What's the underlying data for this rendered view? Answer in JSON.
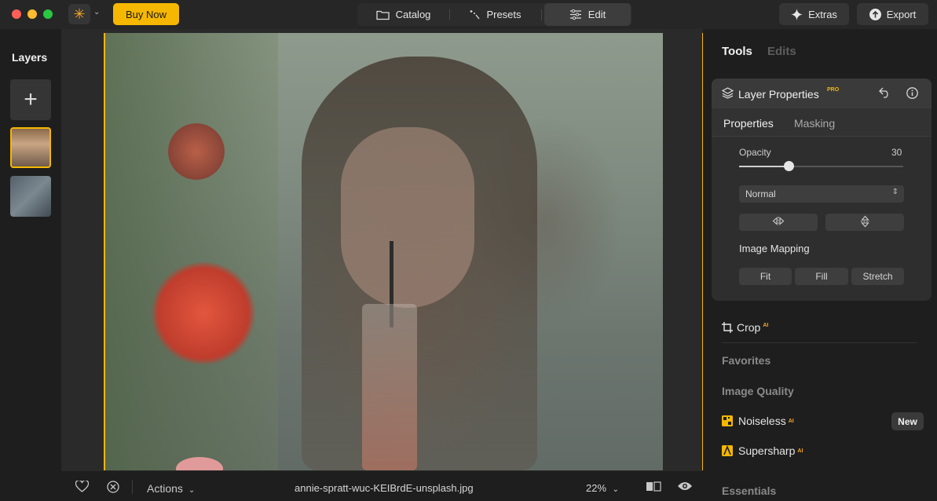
{
  "topbar": {
    "buy_now": "Buy Now",
    "nav": {
      "catalog": "Catalog",
      "presets": "Presets",
      "edit": "Edit"
    },
    "extras": "Extras",
    "export": "Export"
  },
  "layers": {
    "title": "Layers"
  },
  "bottombar": {
    "actions": "Actions",
    "filename": "annie-spratt-wuc-KEIBrdE-unsplash.jpg",
    "zoom": "22%"
  },
  "right": {
    "tabs": {
      "tools": "Tools",
      "edits": "Edits"
    },
    "layer_properties": {
      "title": "Layer Properties",
      "pro_badge": "PRO",
      "subtabs": {
        "properties": "Properties",
        "masking": "Masking"
      },
      "opacity_label": "Opacity",
      "opacity_value": "30",
      "opacity_fraction": 0.3,
      "blend_mode": "Normal",
      "image_mapping_label": "Image Mapping",
      "mapping": {
        "fit": "Fit",
        "fill": "Fill",
        "stretch": "Stretch"
      }
    },
    "crop": "Crop",
    "ai_badge": "AI",
    "sections": {
      "favorites": "Favorites",
      "image_quality": "Image Quality",
      "essentials": "Essentials"
    },
    "tools": {
      "noiseless": "Noiseless",
      "supersharp": "Supersharp"
    },
    "new_badge": "New"
  },
  "colors": {
    "accent": "#f5b700",
    "panel_bg": "#1e1e1e",
    "card_bg": "#2e2e2e"
  }
}
